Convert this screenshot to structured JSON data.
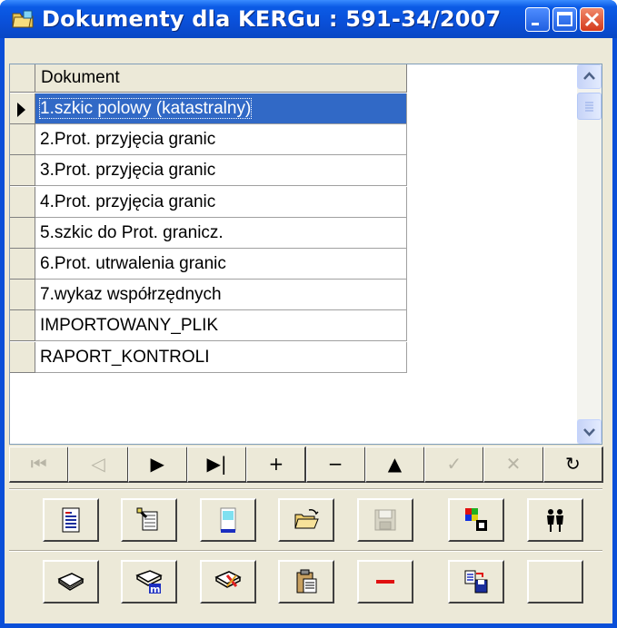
{
  "window": {
    "title": "Dokumenty dla KERGu : 591-34/2007"
  },
  "grid": {
    "column_header": "Dokument",
    "rows": [
      "1.szkic polowy (katastralny)",
      "2.Prot. przyjęcia granic",
      "3.Prot. przyjęcia granic",
      "4.Prot. przyjęcia granic",
      "5.szkic do Prot. granicz.",
      "6.Prot. utrwalenia granic",
      "7.wykaz współrzędnych",
      "IMPORTOWANY_PLIK",
      "RAPORT_KONTROLI"
    ],
    "selected_row_index": 0
  },
  "navigator": {
    "buttons": [
      {
        "name": "first",
        "glyph": "⏮",
        "enabled": false
      },
      {
        "name": "prior",
        "glyph": "◁",
        "enabled": false
      },
      {
        "name": "next",
        "glyph": "▶",
        "enabled": true
      },
      {
        "name": "last",
        "glyph": "▶|",
        "enabled": true
      },
      {
        "name": "insert",
        "glyph": "+",
        "enabled": true
      },
      {
        "name": "delete",
        "glyph": "−",
        "enabled": true
      },
      {
        "name": "edit",
        "glyph": "▲",
        "enabled": true
      },
      {
        "name": "post",
        "glyph": "✓",
        "enabled": false
      },
      {
        "name": "cancel",
        "glyph": "✕",
        "enabled": false
      },
      {
        "name": "refresh",
        "glyph": "↻",
        "enabled": true
      }
    ]
  },
  "toolbar_row1": [
    "document-icon",
    "edit-document-icon",
    "scan-icon",
    "open-folder-icon",
    "save-icon",
    "color-blocks-icon",
    "users-icon"
  ],
  "toolbar_row2": [
    "book-icon",
    "book-m-icon",
    "book-edit-icon",
    "clipboard-icon",
    "remove-icon",
    "convert-icon",
    "empty-button"
  ],
  "colors": {
    "title_bar": "#0a4fd8",
    "selection": "#3169c6",
    "face": "#ece9d8"
  }
}
